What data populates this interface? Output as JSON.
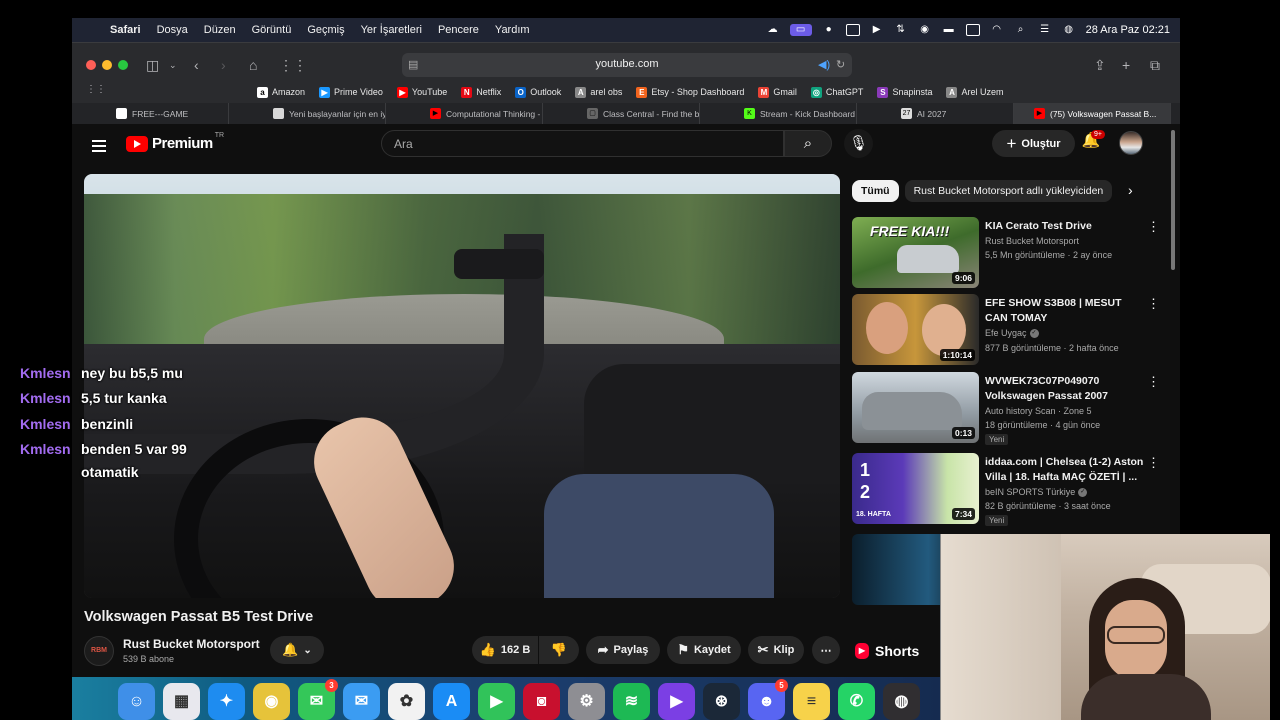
{
  "menubar": {
    "app": "Safari",
    "items": [
      "Dosya",
      "Düzen",
      "Görüntü",
      "Geçmiş",
      "Yer İşaretleri",
      "Pencere",
      "Yardım"
    ],
    "clock": "28 Ara Paz  02:21"
  },
  "safari": {
    "url": "youtube.com",
    "favorites": [
      {
        "label": "Amazon",
        "icon": "amazon-icon",
        "color": "#ffffff",
        "glyph": "a"
      },
      {
        "label": "Prime Video",
        "icon": "prime-video-icon",
        "color": "#1a98ff",
        "glyph": "▶"
      },
      {
        "label": "YouTube",
        "icon": "youtube-icon",
        "color": "#ff0000",
        "glyph": "▶"
      },
      {
        "label": "Netflix",
        "icon": "netflix-icon",
        "color": "#e50914",
        "glyph": "N"
      },
      {
        "label": "Outlook",
        "icon": "outlook-icon",
        "color": "#0a64c8",
        "glyph": "O"
      },
      {
        "label": "arel obs",
        "icon": "arel-icon",
        "color": "#888888",
        "glyph": "A"
      },
      {
        "label": "Etsy - Shop Dashboard",
        "icon": "etsy-icon",
        "color": "#f1641e",
        "glyph": "E"
      },
      {
        "label": "Gmail",
        "icon": "gmail-icon",
        "color": "#ea4335",
        "glyph": "M"
      },
      {
        "label": "ChatGPT",
        "icon": "chatgpt-icon",
        "color": "#10a37f",
        "glyph": "◎"
      },
      {
        "label": "Snapinsta",
        "icon": "snapinsta-icon",
        "color": "#8a3ab9",
        "glyph": "S"
      },
      {
        "label": "Arel Uzem",
        "icon": "arel-uzem-icon",
        "color": "#888888",
        "glyph": "A"
      }
    ],
    "tabs": [
      {
        "label": "FREE---GAME",
        "icon": "page-icon",
        "color": "#ffffff",
        "glyph": ""
      },
      {
        "label": "Yeni başlayanlar için en iyi AI...",
        "icon": "page-icon",
        "color": "#d8d8d8",
        "glyph": ""
      },
      {
        "label": "Computational Thinking - CS...",
        "icon": "youtube-icon",
        "color": "#ff0000",
        "glyph": "▶"
      },
      {
        "label": "Class Central - Find the best...",
        "icon": "class-central-icon",
        "color": "#666666",
        "glyph": "▢"
      },
      {
        "label": "Stream - Kick Dashboard",
        "icon": "kick-icon",
        "color": "#53fc18",
        "glyph": "K"
      },
      {
        "label": "AI 2027",
        "icon": "calendar-icon",
        "color": "#dddddd",
        "glyph": "27"
      },
      {
        "label": "(75) Volkswagen Passat B...",
        "icon": "youtube-icon",
        "color": "#ff0000",
        "glyph": "▶"
      }
    ]
  },
  "youtube": {
    "logo_text": "Premium",
    "logo_country": "TR",
    "search_placeholder": "Ara",
    "create_label": "Oluştur",
    "notification_count": "9+",
    "video": {
      "title": "Volkswagen Passat B5 Test Drive",
      "channel": "Rust Bucket Motorsport",
      "subscribers": "539 B abone",
      "channel_avatar_text": "RBM",
      "likes": "162 B",
      "share_label": "Paylaş",
      "save_label": "Kaydet",
      "clip_label": "Klip"
    },
    "chat": [
      {
        "user": "Kmlesn",
        "message": "ney bu b5,5 mu"
      },
      {
        "user": "Kmlesn",
        "message": "5,5 tur kanka"
      },
      {
        "user": "Kmlesn",
        "message": "benzinli"
      },
      {
        "user": "Kmlesn",
        "message": "benden 5 var 99"
      },
      {
        "user": "",
        "message": "otamatik"
      }
    ],
    "chips": [
      "Tümü",
      "Rust Bucket Motorsport adlı yükleyiciden"
    ],
    "recommendations": [
      {
        "title": "KIA Cerato Test Drive",
        "channel": "Rust Bucket Motorsport",
        "verified": false,
        "stats": "5,5 Mn görüntüleme · 2 ay önce",
        "duration": "9:06",
        "badge": "",
        "thumb_overlay": "FREE KIA!!!"
      },
      {
        "title": "EFE SHOW S3B08 | MESUT CAN TOMAY",
        "channel": "Efe Uygaç",
        "verified": true,
        "stats": "877 B görüntüleme · 2 hafta önce",
        "duration": "1:10:14",
        "badge": "",
        "thumb_overlay": ""
      },
      {
        "title": "WVWEK73C07P049070 Volkswagen Passat 2007",
        "channel": "Auto history Scan · Zone 5",
        "verified": false,
        "stats": "18 görüntüleme · 4 gün önce",
        "duration": "0:13",
        "badge": "Yeni",
        "thumb_overlay": ""
      },
      {
        "title": "iddaa.com | Chelsea (1-2) Aston Villa | 18. Hafta MAÇ ÖZETİ | ...",
        "channel": "beIN SPORTS Türkiye",
        "verified": true,
        "stats": "82 B görüntüleme · 3 saat önce",
        "duration": "7:34",
        "badge": "Yeni",
        "thumb_overlay": "1\n2",
        "thumb_label": "18. HAFTA"
      }
    ],
    "shorts_label": "Shorts"
  },
  "dock": {
    "apps": [
      {
        "name": "finder-icon",
        "color": "#3f8fe8",
        "glyph": "☺",
        "badge": ""
      },
      {
        "name": "launchpad-icon",
        "color": "#e8e8ee",
        "glyph": "▦",
        "badge": ""
      },
      {
        "name": "safari-icon",
        "color": "#1e8cf0",
        "glyph": "✦",
        "badge": ""
      },
      {
        "name": "chrome-icon",
        "color": "#e6c33a",
        "glyph": "◉",
        "badge": ""
      },
      {
        "name": "messages-icon",
        "color": "#34c759",
        "glyph": "✉",
        "badge": "3"
      },
      {
        "name": "mail-icon",
        "color": "#3b9cf2",
        "glyph": "✉",
        "badge": ""
      },
      {
        "name": "photos-icon",
        "color": "#f2f2f2",
        "glyph": "✿",
        "badge": ""
      },
      {
        "name": "app-store-icon",
        "color": "#1a8cf5",
        "glyph": "A",
        "badge": ""
      },
      {
        "name": "facetime-icon",
        "color": "#31c35a",
        "glyph": "▶",
        "badge": ""
      },
      {
        "name": "photobooth-icon",
        "color": "#c8102e",
        "glyph": "◙",
        "badge": ""
      },
      {
        "name": "system-settings-icon",
        "color": "#8e8e93",
        "glyph": "⚙",
        "badge": ""
      },
      {
        "name": "spotify-icon",
        "color": "#1db954",
        "glyph": "≋",
        "badge": ""
      },
      {
        "name": "imovie-icon",
        "color": "#7b3fe4",
        "glyph": "▶",
        "badge": ""
      },
      {
        "name": "steam-icon",
        "color": "#1b2838",
        "glyph": "⊛",
        "badge": ""
      },
      {
        "name": "discord-icon",
        "color": "#5865f2",
        "glyph": "☻",
        "badge": "5"
      },
      {
        "name": "notes-icon",
        "color": "#f7d24a",
        "glyph": "≡",
        "badge": ""
      },
      {
        "name": "whatsapp-icon",
        "color": "#25d366",
        "glyph": "✆",
        "badge": ""
      },
      {
        "name": "obs-icon",
        "color": "#302e31",
        "glyph": "◍",
        "badge": ""
      }
    ]
  }
}
